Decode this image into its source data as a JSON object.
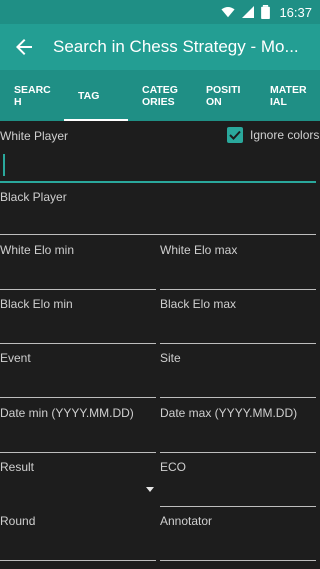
{
  "status_bar": {
    "time": "16:37"
  },
  "app_bar": {
    "title": "Search in Chess Strategy - Mo..."
  },
  "tabs": [
    {
      "label": "SEARCH"
    },
    {
      "label": "TAG"
    },
    {
      "label": "CATEGORIES"
    },
    {
      "label": "POSITION"
    },
    {
      "label": "MATERIAL"
    }
  ],
  "form": {
    "white_player": "White Player",
    "ignore_colors": "Ignore colors",
    "black_player": "Black Player",
    "white_elo_min": "White Elo min",
    "white_elo_max": "White Elo max",
    "black_elo_min": "Black Elo min",
    "black_elo_max": "Black Elo max",
    "event": "Event",
    "site": "Site",
    "date_min": "Date min (YYYY.MM.DD)",
    "date_max": "Date max (YYYY.MM.DD)",
    "result": "Result",
    "eco": "ECO",
    "round": "Round",
    "annotator": "Annotator"
  },
  "colors": {
    "accent": "#239e93",
    "background": "#1d1d1d"
  }
}
